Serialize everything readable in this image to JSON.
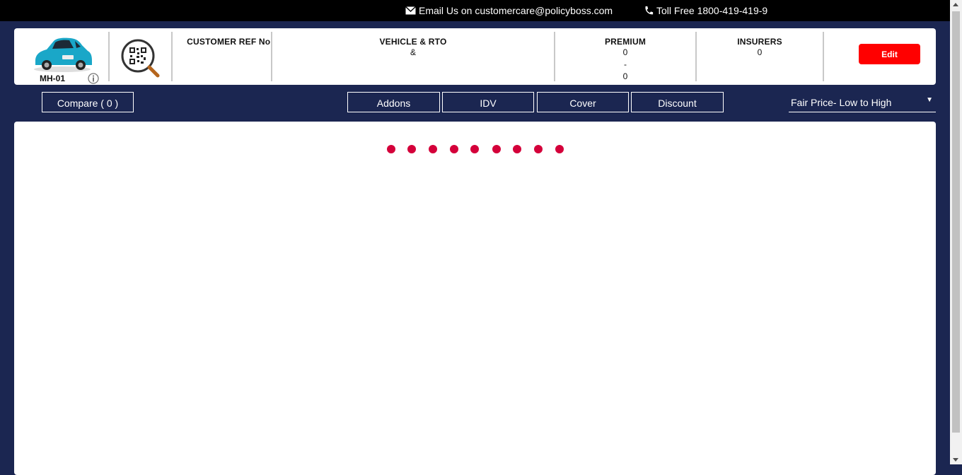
{
  "topbar": {
    "email_text": "Email Us on customercare@policyboss.com",
    "tollfree_text": "Toll Free 1800-419-419-9"
  },
  "vehicle": {
    "rto_code": "MH-01"
  },
  "header": {
    "customer_ref_label": "CUSTOMER REF No.",
    "customer_ref_value": "",
    "vehicle_rto_label": "VEHICLE & RTO",
    "vehicle_rto_value": "&",
    "premium_label": "PREMIUM",
    "premium_min": "0",
    "premium_sep": "-",
    "premium_max": "0",
    "insurers_label": "INSURERS",
    "insurers_value": "0",
    "edit_label": "Edit"
  },
  "toolbar": {
    "compare_label": "Compare ( 0 )",
    "filters": [
      "Addons",
      "IDV",
      "Cover",
      "Discount"
    ],
    "sort_selected": "Fair Price- Low to High"
  },
  "colors": {
    "brand_navy": "#1b2651",
    "edit_red": "#ff0000",
    "loader_dot": "#d4003a"
  },
  "icons": [
    "envelope-icon",
    "phone-icon",
    "car-image",
    "qr-search-icon",
    "info-icon",
    "chevron-down-icon"
  ]
}
